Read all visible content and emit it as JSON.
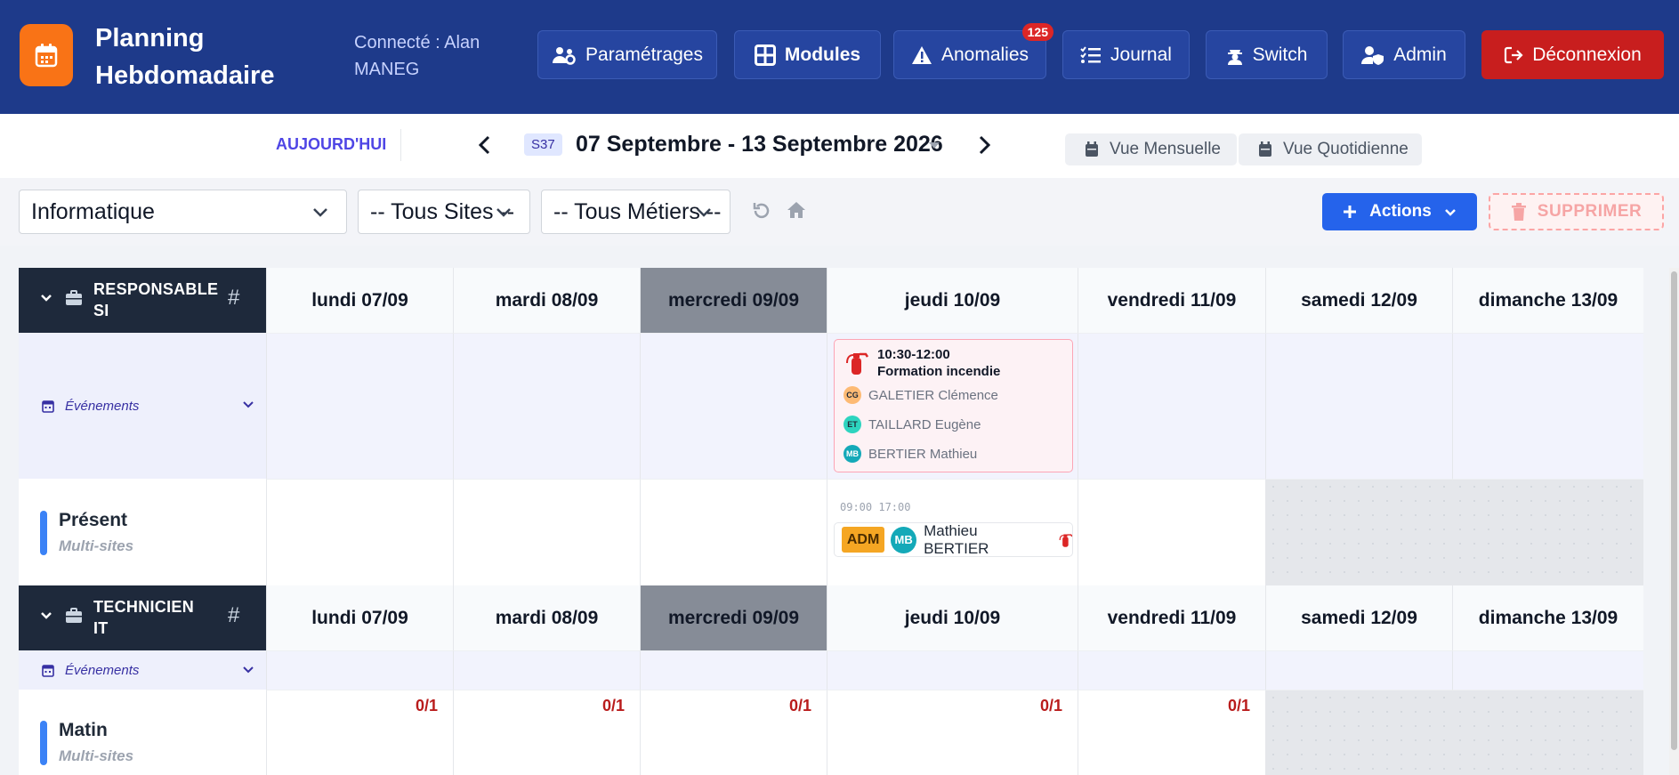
{
  "header": {
    "title_line1": "Planning",
    "title_line2": "Hebdomadaire",
    "connected_line1": "Connecté : Alan",
    "connected_line2": "MANEG",
    "buttons": {
      "settings": "Paramétrages",
      "modules": "Modules",
      "anomalies": "Anomalies",
      "anomalies_count": "125",
      "journal": "Journal",
      "switch": "Switch",
      "admin": "Admin",
      "logout": "Déconnexion"
    }
  },
  "datebar": {
    "today": "AUJOURD'HUI",
    "week_badge": "S37",
    "week_range": "07 Septembre - 13 Septembre 2026",
    "view_month": "Vue Mensuelle",
    "view_day": "Vue Quotidienne"
  },
  "filters": {
    "department": "Informatique",
    "sites": "-- Tous Sites --",
    "jobs": "-- Tous Métiers --",
    "actions": "Actions",
    "delete": "SUPPRIMER"
  },
  "days": [
    "lundi 07/09",
    "mardi 08/09",
    "mercredi 09/09",
    "jeudi 10/09",
    "vendredi 11/09",
    "samedi 12/09",
    "dimanche 13/09"
  ],
  "sections": [
    {
      "title_line1": "RESPONSABLE",
      "title_line2": "SI",
      "hash": "#",
      "events_label": "Événements",
      "event": {
        "time": "10:30-12:00",
        "title": "Formation incendie",
        "participants": [
          {
            "initials": "CG",
            "name": "GALETIER Clémence",
            "color": "#fdba74"
          },
          {
            "initials": "ET",
            "name": "TAILLARD Eugène",
            "color": "#2dd4bf"
          },
          {
            "initials": "MB",
            "name": "BERTIER Mathieu",
            "color": "#14a9b8"
          }
        ]
      },
      "row": {
        "name": "Présent",
        "sub": "Multi-sites",
        "shift_time": "09:00 17:00",
        "shift_tag": "ADM",
        "shift_initials": "MB",
        "shift_person": "Mathieu BERTIER"
      }
    },
    {
      "title_line1": "TECHNICIEN",
      "title_line2": "IT",
      "hash": "#",
      "events_label": "Événements",
      "row": {
        "name": "Matin",
        "sub": "Multi-sites",
        "ratios": [
          "0/1",
          "0/1",
          "0/1",
          "0/1",
          "0/1"
        ]
      }
    }
  ],
  "colors": {
    "header_bg": "#1e3a8a",
    "logo_bg": "#f97316",
    "logout_bg": "#c81e1e",
    "accent": "#2563eb",
    "today_col": "#868c97",
    "ratio_red": "#b91c1c"
  }
}
